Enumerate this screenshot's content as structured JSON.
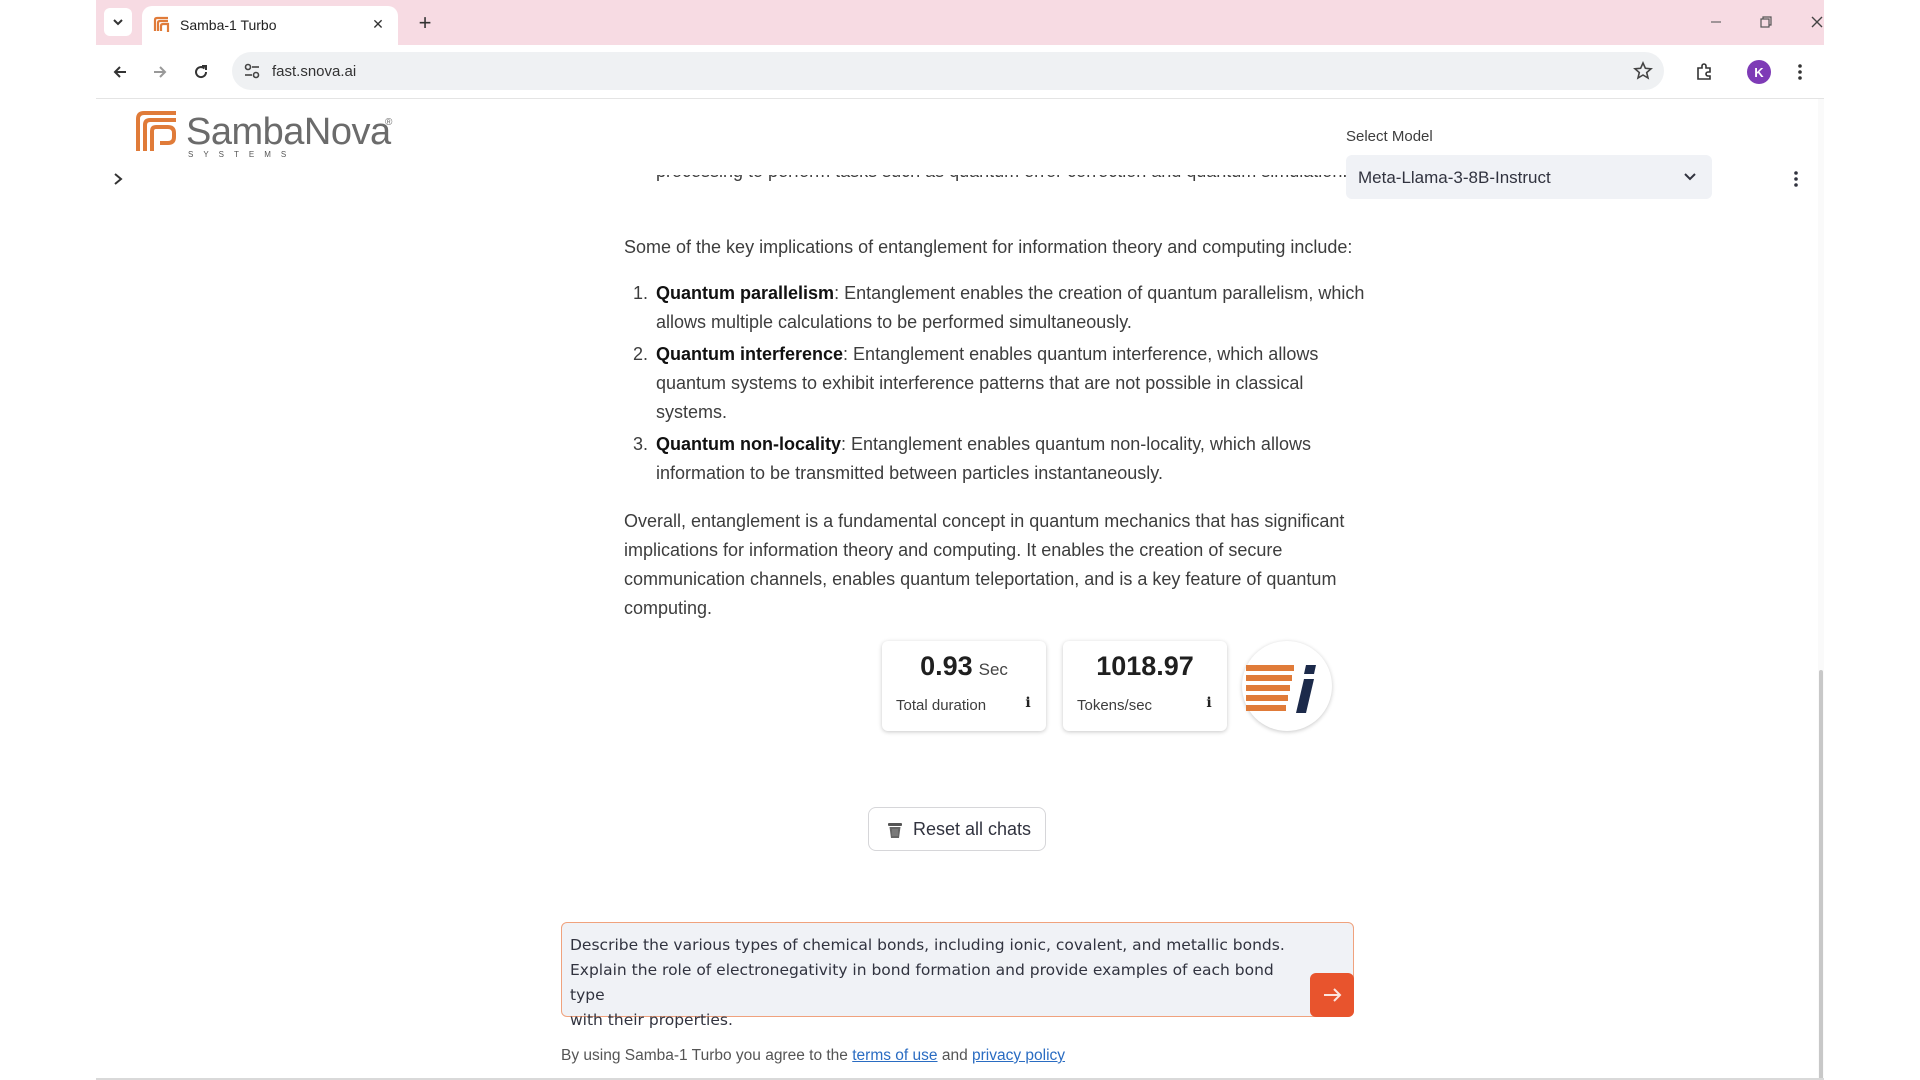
{
  "browser": {
    "tab_title": "Samba-1 Turbo",
    "url": "fast.snova.ai",
    "profile_initial": "K"
  },
  "header": {
    "logo_text": "SambaNova",
    "logo_sub": "SYSTEMS",
    "logo_reg": "®",
    "select_label": "Select Model",
    "selected_model": "Meta-Llama-3-8B-Instruct"
  },
  "chat": {
    "cut_off_line": "processing to perform tasks such as quantum error correction and quantum simulation.",
    "intro": "Some of the key implications of entanglement for information theory and computing include:",
    "list": [
      {
        "num": "1.",
        "title": "Quantum parallelism",
        "text": ": Entanglement enables the creation of quantum parallelism, which allows multiple calculations to be performed simultaneously."
      },
      {
        "num": "2.",
        "title": "Quantum interference",
        "text": ": Entanglement enables quantum interference, which allows quantum systems to exhibit interference patterns that are not possible in classical systems."
      },
      {
        "num": "3.",
        "title": "Quantum non-locality",
        "text": ": Entanglement enables quantum non-locality, which allows information to be transmitted between particles instantaneously."
      }
    ],
    "conclusion": "Overall, entanglement is a fundamental concept in quantum mechanics that has significant implications for information theory and computing. It enables the creation of secure communication channels, enables quantum teleportation, and is a key feature of quantum computing."
  },
  "metrics": {
    "duration_value": "0.93",
    "duration_unit": "Sec",
    "duration_label": "Total duration",
    "tokens_value": "1018.97",
    "tokens_label": "Tokens/sec",
    "info_glyph": "i"
  },
  "actions": {
    "reset_label": "Reset all chats"
  },
  "prompt": {
    "text": "Describe the various types of chemical bonds, including ionic, covalent, and metallic bonds.\nExplain the role of electronegativity in bond formation and provide examples of each bond type\nwith their properties."
  },
  "footer": {
    "prefix": "By using Samba-1 Turbo you agree to the ",
    "terms": "terms of use",
    "and": " and ",
    "privacy": "privacy policy"
  },
  "colors": {
    "accent": "#e8542d",
    "tabstrip": "#f7dbe3",
    "logo_orange": "#e07b39",
    "badge_navy": "#1c2a4a"
  }
}
